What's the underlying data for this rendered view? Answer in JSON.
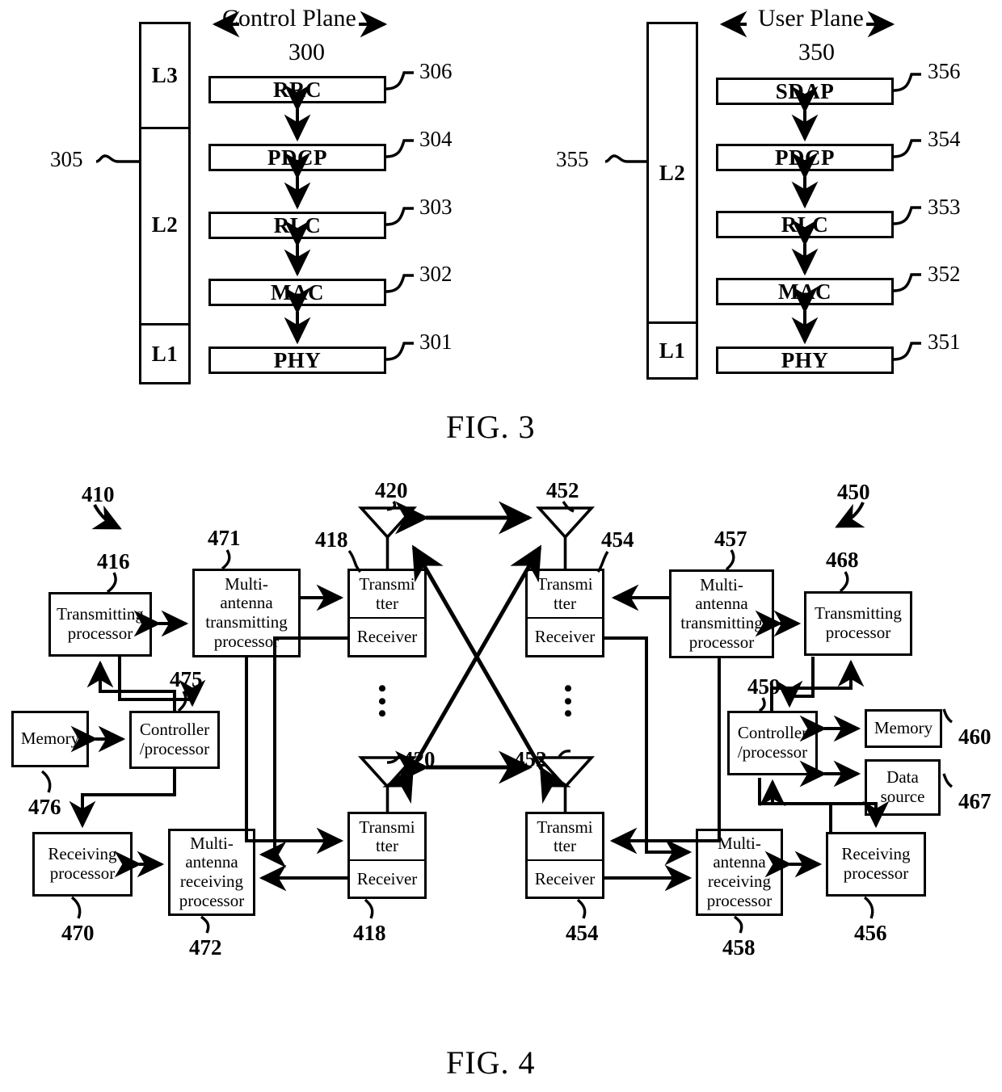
{
  "figures": [
    {
      "caption": "FIG. 3",
      "panels": [
        {
          "title": "Control Plane",
          "title_ref": "300",
          "column_ref": "305",
          "layers": [
            "L3",
            "L2",
            "L1"
          ],
          "entities": [
            {
              "label": "RRC",
              "ref": "306"
            },
            {
              "label": "PDCP",
              "ref": "304"
            },
            {
              "label": "RLC",
              "ref": "303"
            },
            {
              "label": "MAC",
              "ref": "302"
            },
            {
              "label": "PHY",
              "ref": "301"
            }
          ]
        },
        {
          "title": "User Plane",
          "title_ref": "350",
          "column_ref": "355",
          "layers": [
            "L2",
            "L1"
          ],
          "entities": [
            {
              "label": "SDAP",
              "ref": "356"
            },
            {
              "label": "PDCP",
              "ref": "354"
            },
            {
              "label": "RLC",
              "ref": "353"
            },
            {
              "label": "MAC",
              "ref": "352"
            },
            {
              "label": "PHY",
              "ref": "351"
            }
          ]
        }
      ]
    },
    {
      "caption": "FIG. 4",
      "device_refs": {
        "left": "410",
        "right": "450"
      },
      "blocks": {
        "tx_processor_left": {
          "label": "Transmitting\nprocessor",
          "ref": "416"
        },
        "ma_tx_processor_left": {
          "label": "Multi-\nantenna\ntransmitting\nprocessor",
          "ref": "471"
        },
        "transmitter_top_left": {
          "label_top": "Transmi\ntter",
          "label_bottom": "Receiver",
          "ref": "418"
        },
        "antenna_top_left": {
          "ref": "420"
        },
        "memory_left": {
          "label": "Memory",
          "ref": "476"
        },
        "controller_left": {
          "label": "Controller\n/processor",
          "ref": "475"
        },
        "rx_processor_left": {
          "label": "Receiving\nprocessor",
          "ref": "470"
        },
        "ma_rx_processor_left": {
          "label": "Multi-\nantenna\nreceiving\nprocessor",
          "ref": "472"
        },
        "transmitter_bottom_left": {
          "label_top": "Transmi\ntter",
          "label_bottom": "Receiver",
          "ref": "418"
        },
        "antenna_bottom_left": {
          "ref": "420"
        },
        "transmitter_top_right": {
          "label_top": "Transmi\ntter",
          "label_bottom": "Receiver",
          "ref": "454"
        },
        "antenna_top_right": {
          "ref": "452"
        },
        "ma_tx_processor_right": {
          "label": "Multi-\nantenna\ntransmitting\nprocessor",
          "ref": "457"
        },
        "tx_processor_right": {
          "label": "Transmitting\nprocessor",
          "ref": "468"
        },
        "controller_right": {
          "label": "Controller\n/processor",
          "ref": "459"
        },
        "memory_right": {
          "label": "Memory",
          "ref": "460"
        },
        "data_source_right": {
          "label": "Data\nsource",
          "ref": "467"
        },
        "ma_rx_processor_right": {
          "label": "Multi-\nantenna\nreceiving\nprocessor",
          "ref": "458"
        },
        "rx_processor_right": {
          "label": "Receiving\nprocessor",
          "ref": "456"
        },
        "transmitter_bottom_right": {
          "label_top": "Transmi\ntter",
          "label_bottom": "Receiver",
          "ref": "454"
        },
        "antenna_bottom_right": {
          "ref": "452"
        }
      },
      "ellipsis": "•\n•\n•"
    }
  ],
  "colors": {
    "ink": "#000000",
    "paper": "#ffffff"
  }
}
